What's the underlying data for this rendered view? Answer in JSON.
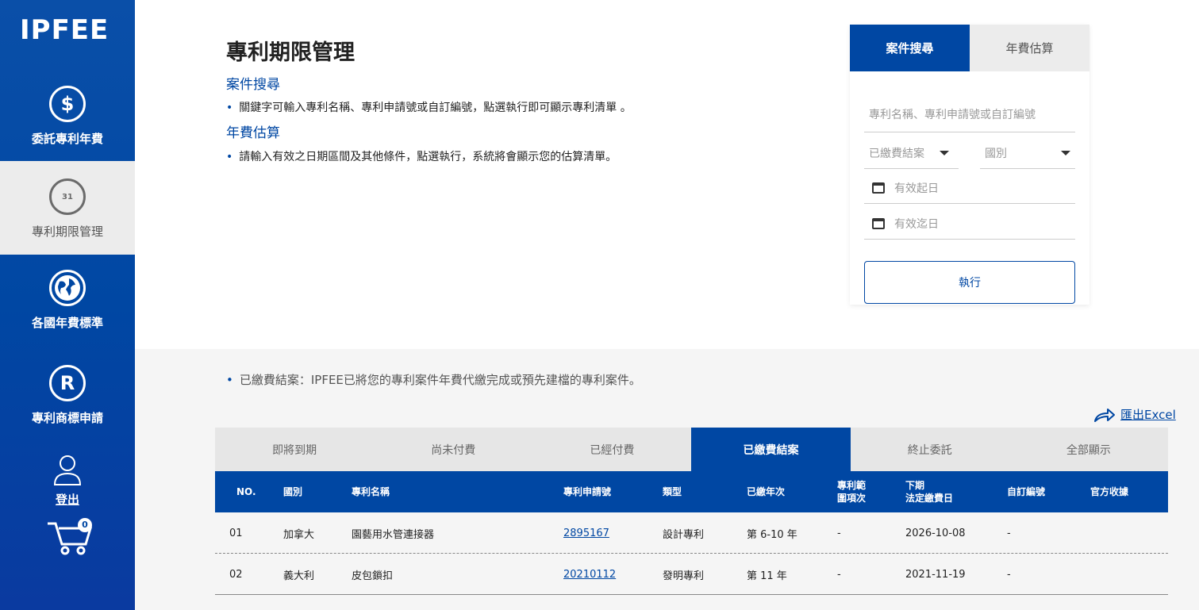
{
  "sidebar": {
    "logo": "IPFEE",
    "items": [
      {
        "label": "委託專利年費",
        "icon": "dollar-icon"
      },
      {
        "label": "專利期限管理",
        "icon": "calendar-icon"
      },
      {
        "label": "各國年費標準",
        "icon": "globe-icon"
      },
      {
        "label": "專利商標申請",
        "icon": "registered-icon"
      }
    ],
    "logout_label": "登出",
    "cart_count": "0"
  },
  "header": {
    "title": "專利期限管理",
    "section1_title": "案件搜尋",
    "section1_text": "關鍵字可輸入專利名稱、專利申請號或自訂編號，點選執行即可顯示專利清單 。",
    "section2_title": "年費估算",
    "section2_text": "請輸入有效之日期區間及其他條件，點選執行，系統將會顯示您的估算清單。"
  },
  "search_panel": {
    "tabs": [
      "案件搜尋",
      "年費估算"
    ],
    "keyword_placeholder": "專利名稱、專利申請號或自訂編號",
    "status_select": "已繳費結案",
    "country_select": "國別",
    "start_date_placeholder": "有效起日",
    "end_date_placeholder": "有效迄日",
    "execute_label": "執行"
  },
  "results": {
    "note": "已繳費結案：IPFEE已將您的專利案件年費代繳完成或預先建檔的專利案件。",
    "export_label": "匯出Excel",
    "tabs": [
      "即將到期",
      "尚未付費",
      "已經付費",
      "已繳費結案",
      "終止委託",
      "全部顯示"
    ],
    "active_tab": "已繳費結案",
    "columns": {
      "no": "NO.",
      "country": "國別",
      "name": "專利名稱",
      "app_no": "專利申請號",
      "type": "類型",
      "paid_years": "已繳年次",
      "claims_1": "專利範",
      "claims_2": "圍項次",
      "next_due_1": "下期",
      "next_due_2": "法定繳費日",
      "custom_no": "自訂編號",
      "receipt": "官方收據"
    },
    "rows": [
      {
        "no": "01",
        "country": "加拿大",
        "name": "園藝用水管連接器",
        "app_no": "2895167",
        "type": "設計專利",
        "paid_years": "第 6-10 年",
        "claims": "-",
        "next_due": "2026-10-08",
        "custom_no": "-",
        "receipt": ""
      },
      {
        "no": "02",
        "country": "義大利",
        "name": "皮包鎖扣",
        "app_no": "20210112",
        "type": "發明專利",
        "paid_years": "第 11 年",
        "claims": "-",
        "next_due": "2021-11-19",
        "custom_no": "-",
        "receipt": ""
      }
    ]
  },
  "colors": {
    "primary": "#0047a3",
    "sidebar_active_bg": "#ececec",
    "lower_bg": "#f5f5f5"
  }
}
